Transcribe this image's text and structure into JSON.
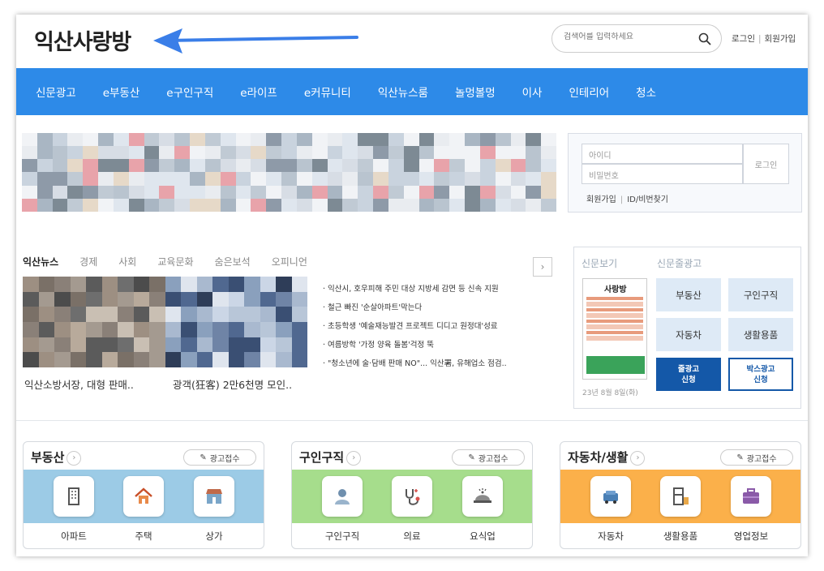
{
  "header": {
    "logo_part1": "익산",
    "logo_part2": "사랑방",
    "search_placeholder": "검색어를 입력하세요",
    "login_link": "로그인",
    "signup_link": "회원가입"
  },
  "nav": [
    "신문광고",
    "e부동산",
    "e구인구직",
    "e라이프",
    "e커뮤니티",
    "익산뉴스룸",
    "놀멍볼멍",
    "이사",
    "인테리어",
    "청소"
  ],
  "login": {
    "id_placeholder": "아이디",
    "pw_placeholder": "비밀번호",
    "button": "로그인",
    "signup": "회원가입",
    "find": "ID/비번찾기"
  },
  "news": {
    "tabs": [
      "익산뉴스",
      "경제",
      "사회",
      "교육문화",
      "숨은보석",
      "오피니언"
    ],
    "thumbs": [
      "익산소방서장, 대형 판매..",
      "광객(狂客) 2만6천명 모인.."
    ],
    "list": [
      "· 익산시, 호우피해 주민 대상 지방세 감면 등 신속 지원",
      "· 철근 빠진 '순살아파트'막는다",
      "· 초등학생 '예술재능발견 프로젝트 디디고 원정대'성료",
      "· 여름방학 '가정 양육 돌봄'걱정 뚝",
      "· \"청소년에 술·담배 판매 NO\"... 익산署, 유해업소 점검.."
    ]
  },
  "adpanel": {
    "title_paper": "신문보기",
    "title_class": "신문줄광고",
    "paper_date": "23년 8월 8일(화)",
    "paper_name": "사랑방",
    "categories": [
      "부동산",
      "구인구직",
      "자동차",
      "생활용품"
    ],
    "cta_line": [
      "줄광고",
      "신청"
    ],
    "cta_box": [
      "박스광고",
      "신청"
    ]
  },
  "cards": [
    {
      "title": "부동산",
      "ad_button": "광고접수",
      "items": [
        "아파트",
        "주택",
        "상가"
      ]
    },
    {
      "title": "구인구직",
      "ad_button": "광고접수",
      "items": [
        "구인구직",
        "의료",
        "요식업"
      ]
    },
    {
      "title": "자동차/생활",
      "ad_button": "광고접수",
      "items": [
        "자동차",
        "생활용품",
        "영업정보"
      ]
    }
  ],
  "colors": {
    "nav": "#2d8ae8",
    "card_band": [
      "#9ccbe6",
      "#a6dd8c",
      "#fbb04a"
    ],
    "cta": "#1458a8",
    "arrow": "#3a7ee8"
  }
}
